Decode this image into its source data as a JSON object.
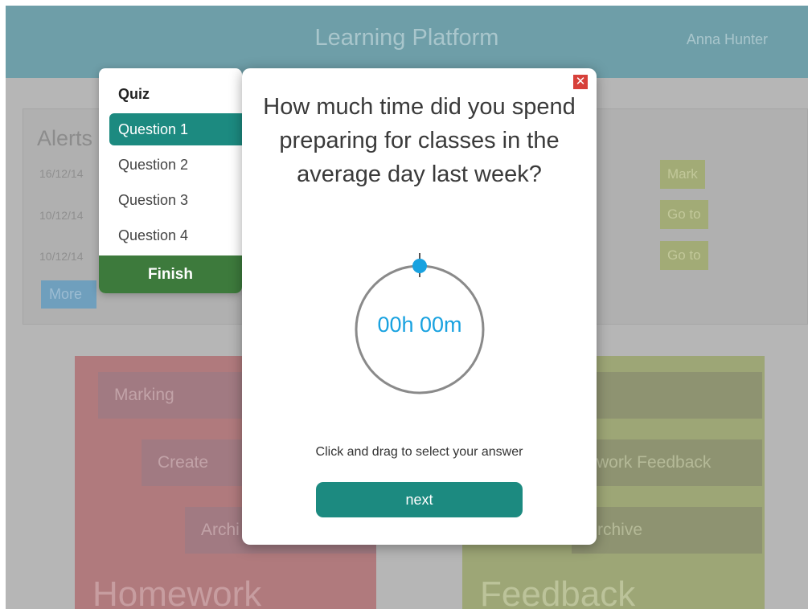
{
  "header": {
    "title": "Learning Platform",
    "user": "Anna Hunter"
  },
  "alerts": {
    "title": "Alerts",
    "items": [
      {
        "date": "16/12/14",
        "action": "Mark"
      },
      {
        "date": "10/12/14",
        "action": "Go to"
      },
      {
        "date": "10/12/14",
        "action": "Go to"
      }
    ],
    "more_label": "More"
  },
  "homework_tile": {
    "label": "Homework",
    "items": [
      "Marking",
      "Create",
      "Archi"
    ]
  },
  "feedback_tile": {
    "label": "Feedback",
    "items": [
      "",
      "work Feedback",
      "rchive"
    ]
  },
  "quiz": {
    "heading": "Quiz",
    "questions": [
      "Question 1",
      "Question 2",
      "Question 3",
      "Question 4"
    ],
    "active_index": 0,
    "finish_label": "Finish"
  },
  "modal": {
    "close_glyph": "✕",
    "question": "How much time did you spend preparing for classes in the average day last week?",
    "dial_value": "00h 00m",
    "instruction": "Click and drag to select your answer",
    "next_label": "next"
  },
  "colors": {
    "accent": "#1c8a80",
    "dial_blue": "#19a2e0",
    "finish_green": "#3d7a3c",
    "close_red": "#d7403a"
  }
}
